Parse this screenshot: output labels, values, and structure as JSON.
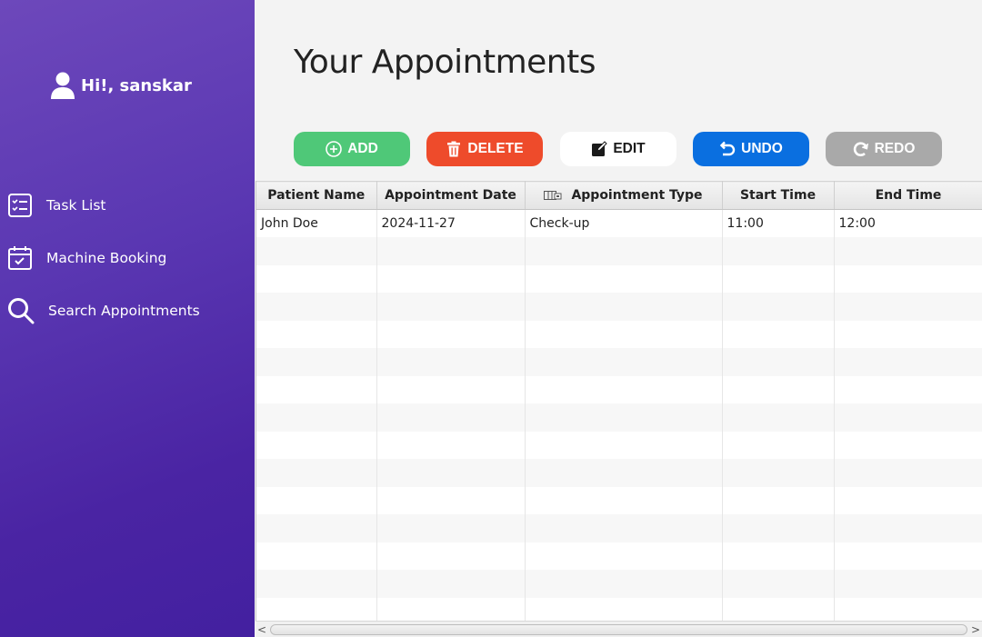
{
  "sidebar": {
    "greeting": "Hi!, sanskar",
    "items": [
      {
        "label": "Task List",
        "icon": "task-list-icon"
      },
      {
        "label": "Machine Booking",
        "icon": "calendar-check-icon"
      },
      {
        "label": "Search Appointments",
        "icon": "search-icon"
      }
    ],
    "colors": {
      "top": "#6d48bb",
      "bottom": "#4320a0"
    }
  },
  "main": {
    "title": "Your Appointments",
    "toolbar": {
      "add_label": "ADD",
      "delete_label": "DELETE",
      "edit_label": "EDIT",
      "undo_label": "UNDO",
      "redo_label": "REDO"
    },
    "colors": {
      "add": "#4fc878",
      "delete": "#ee4b2b",
      "edit": "#ffffff",
      "undo": "#0a6fe0",
      "redo": "#a9a9a9"
    },
    "table": {
      "columns": [
        "Patient Name",
        "Appointment Date",
        "Appointment Type",
        "Start Time",
        "End Time"
      ],
      "rows": [
        [
          "John Doe",
          "2024-11-27",
          "Check-up",
          "11:00",
          "12:00"
        ]
      ]
    },
    "scrollbar": {
      "left_arrow": "<",
      "right_arrow": ">"
    }
  }
}
